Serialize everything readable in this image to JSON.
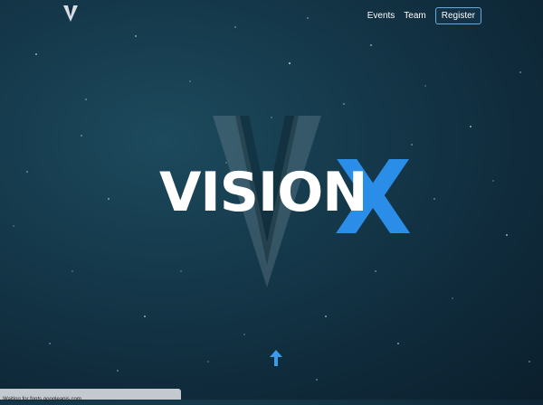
{
  "nav": {
    "events_label": "Events",
    "team_label": "Team",
    "register_label": "Register"
  },
  "hero": {
    "title_word": "VISION",
    "title_letter": "X"
  },
  "status_bar": {
    "text": "Waiting for fonts.googleapis.com..."
  },
  "colors": {
    "accent": "#2a8ee8",
    "background": "#153a4c",
    "text": "#ffffff"
  },
  "icons": {
    "brand": "v-logo-icon",
    "scroll": "arrow-up-icon"
  }
}
